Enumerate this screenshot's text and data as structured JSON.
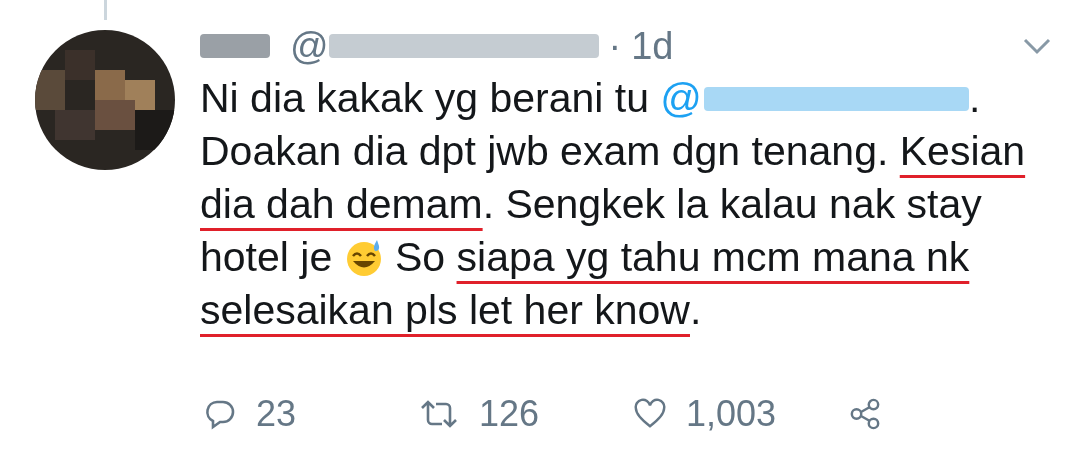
{
  "tweet": {
    "header": {
      "name_redacted": true,
      "handle_prefix": "@",
      "handle_redacted": true,
      "separator": "·",
      "time": "1d"
    },
    "lines": [
      [
        {
          "kind": "text",
          "text": "Ni dia kakak yg berani tu ",
          "underlined": false
        },
        {
          "kind": "mention",
          "text": "@"
        },
        {
          "kind": "text",
          "text": ".",
          "underlined": false
        }
      ],
      [
        {
          "kind": "text",
          "text": "Doakan dia dpt jwb exam dgn tenang. ",
          "underlined": false
        },
        {
          "kind": "text",
          "text": "Kesian",
          "underlined": true
        }
      ],
      [
        {
          "kind": "text",
          "text": "dia dah demam",
          "underlined": true
        },
        {
          "kind": "text",
          "text": ". Sengkek la kalau nak stay",
          "underlined": false
        }
      ],
      [
        {
          "kind": "text",
          "text": "hotel je ",
          "underlined": false
        },
        {
          "kind": "emoji"
        },
        {
          "kind": "text",
          "text": " So ",
          "underlined": false
        },
        {
          "kind": "text",
          "text": "siapa yg tahu mcm mana nk",
          "underlined": true
        }
      ],
      [
        {
          "kind": "text",
          "text": "selesaikan pls let her know",
          "underlined": true
        },
        {
          "kind": "text",
          "text": ".",
          "underlined": false
        }
      ]
    ],
    "actions": [
      {
        "kind": "reply",
        "count": "23"
      },
      {
        "kind": "retweet",
        "count": "126"
      },
      {
        "kind": "like",
        "count": "1,003"
      },
      {
        "kind": "share"
      }
    ]
  }
}
